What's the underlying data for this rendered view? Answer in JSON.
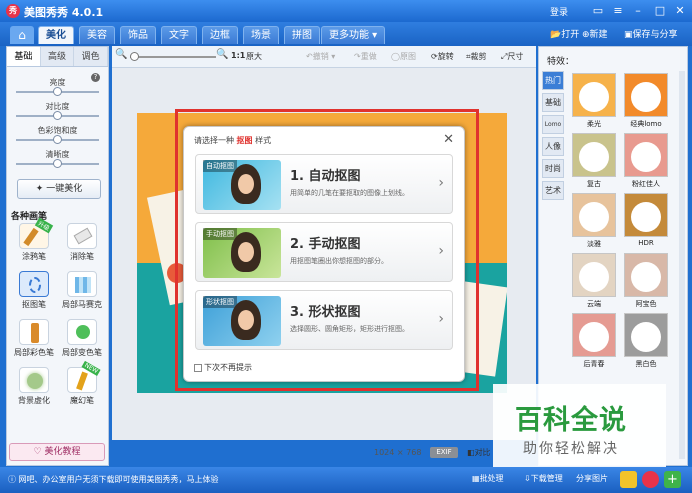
{
  "window": {
    "title": "美图秀秀 4.0.1",
    "login": "登录"
  },
  "menu": {
    "tabs": [
      "美化",
      "美容",
      "饰品",
      "文字",
      "边框",
      "场景",
      "拼图",
      "更多功能"
    ],
    "active_tab": "美化",
    "open": "打开",
    "new": "新建",
    "save": "保存与分享"
  },
  "left": {
    "subtabs": [
      "基础",
      "高级",
      "调色"
    ],
    "sliders": [
      {
        "label": "亮度",
        "value": 0.5
      },
      {
        "label": "对比度",
        "value": 0.5
      },
      {
        "label": "色彩饱和度",
        "value": 0.5
      },
      {
        "label": "清晰度",
        "value": 0.5
      }
    ],
    "onekey": "一键美化",
    "section": "各种画笔",
    "tools": [
      "涂鸦笔",
      "消除笔",
      "抠图笔",
      "局部马赛克",
      "局部彩色笔",
      "局部变色笔",
      "背景虚化",
      "魔幻笔"
    ],
    "tool_badge_new": "升级",
    "tool_badge_hot": "NEW",
    "tutorial": "美化教程"
  },
  "toolbar": {
    "ratio": "1:1",
    "original": "原大",
    "undo": "撤销",
    "redo": "重做",
    "original_img": "原图",
    "rotate": "旋转",
    "crop": "裁剪",
    "resize": "尺寸"
  },
  "canvas": {
    "size": "1024 × 768",
    "exif": "EXIF",
    "compare": "对比"
  },
  "dialog": {
    "header_pre": "请选择一种",
    "header_em": "抠图",
    "header_post": "样式",
    "options": [
      {
        "tag": "自动抠图",
        "title": "1. 自动抠图",
        "desc": "用简单的几笔在要抠取的图像上划线。"
      },
      {
        "tag": "手动抠图",
        "title": "2. 手动抠图",
        "desc": "用抠图笔圈出你想抠图的部分。"
      },
      {
        "tag": "形状抠图",
        "title": "3. 形状抠图",
        "desc": "选择圆形、圆角矩形，矩形进行抠图。"
      }
    ],
    "checkbox": "下次不再提示"
  },
  "right": {
    "title": "特效：",
    "vtabs": [
      "热门",
      "基础",
      "Lomo",
      "人像",
      "时尚",
      "艺术"
    ],
    "effects": [
      "柔光",
      "经典lomo",
      "复古",
      "粉红佳人",
      "淡雅",
      "HDR",
      "云端",
      "阿宝色",
      "后青春",
      "黑白色"
    ],
    "effect_colors": [
      "#f6b24a",
      "#f28a2a",
      "#c9c38c",
      "#e89a8f",
      "#e7c39c",
      "#c48a3a",
      "#e3d4c2",
      "#d8b8a8",
      "#e59b92",
      "#9c9c9c"
    ]
  },
  "status": {
    "msg": "网吧、办公室用户无须下载即可使用美图秀秀，马上体验",
    "batch": "批处理",
    "download": "下载管理",
    "share": "分享图片"
  },
  "watermark": {
    "big": "百科全说",
    "small": "助你轻松解决"
  }
}
